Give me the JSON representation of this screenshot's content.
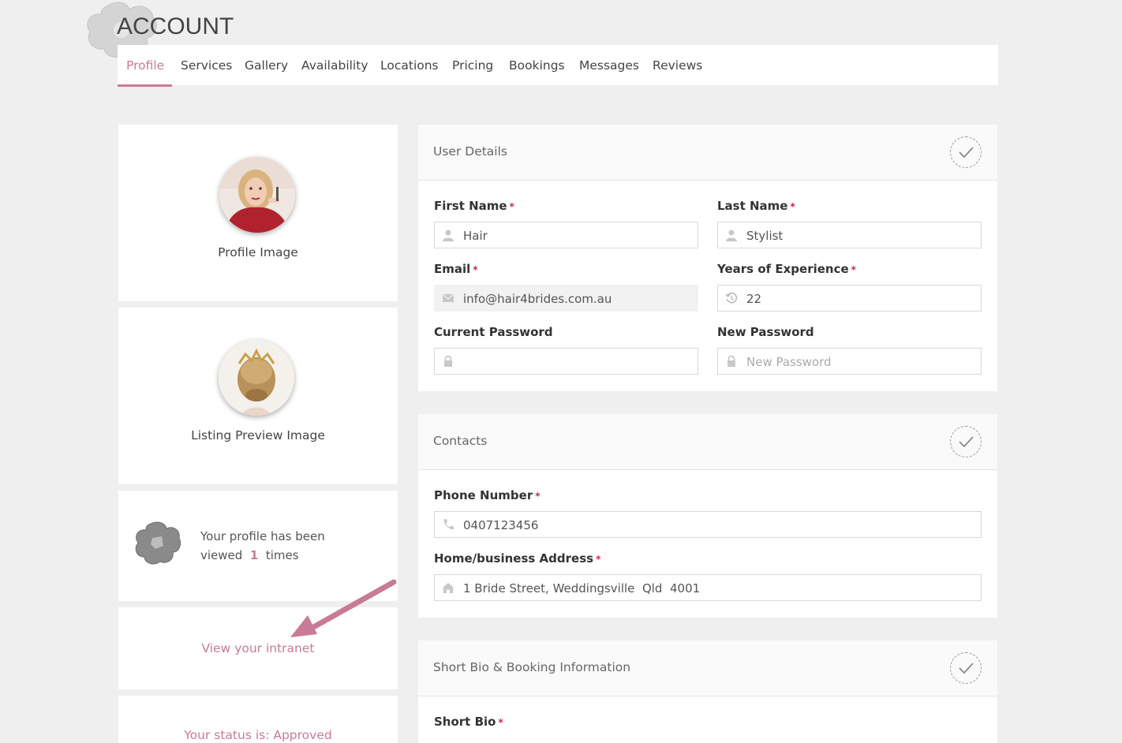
{
  "header": {
    "title": "ACCOUNT"
  },
  "tabs": [
    {
      "label": "Profile",
      "active": true
    },
    {
      "label": "Services"
    },
    {
      "label": "Gallery"
    },
    {
      "label": "Availability"
    },
    {
      "label": "Locations"
    },
    {
      "label": "Pricing"
    },
    {
      "label": "Bookings"
    },
    {
      "label": "Messages"
    },
    {
      "label": "Reviews"
    }
  ],
  "sidebar": {
    "profile_image_label": "Profile Image",
    "listing_image_label": "Listing Preview Image",
    "views_line1": "Your profile has been",
    "views_pre": "viewed",
    "views_count": "1",
    "views_post": "times",
    "intranet_link": "View your intranet",
    "status_text": "Your status is: Approved"
  },
  "user_details": {
    "title": "User Details",
    "first_name_label": "First Name",
    "first_name_value": "Hair",
    "last_name_label": "Last Name",
    "last_name_value": "Stylist",
    "email_label": "Email",
    "email_value": "info@hair4brides.com.au",
    "experience_label": "Years of Experience",
    "experience_value": "22",
    "current_password_label": "Current Password",
    "current_password_value": "",
    "new_password_label": "New Password",
    "new_password_placeholder": "New Password",
    "required_mark": "*"
  },
  "contacts": {
    "title": "Contacts",
    "phone_label": "Phone Number",
    "phone_value": "0407123456",
    "address_label": "Home/business Address",
    "address_value": "1 Bride Street, Weddingsville  Qld  4001"
  },
  "bio": {
    "title": "Short Bio & Booking Information",
    "short_bio_label": "Short Bio"
  },
  "colors": {
    "accent": "#c97a96",
    "required": "#d0234a",
    "background": "#efefef"
  },
  "icons": [
    "logo-flower-icon",
    "user-icon",
    "envelope-icon",
    "history-icon",
    "lock-icon",
    "phone-icon",
    "home-icon",
    "check-icon",
    "arrow-annotation"
  ]
}
